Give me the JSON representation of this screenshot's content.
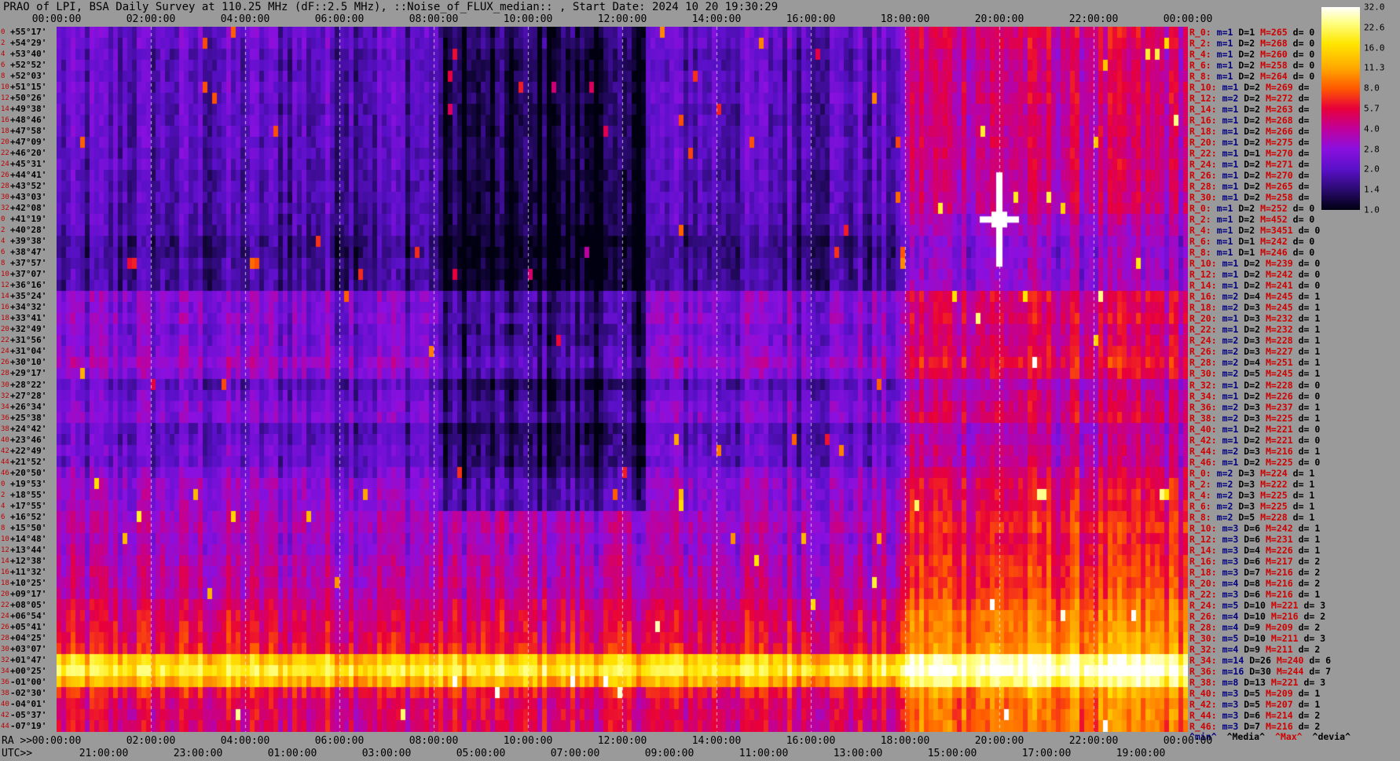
{
  "title": "PRAO of LPI, BSA Daily Survey at 110.25 MHz (dF::2.5 MHz), ::Noise_of_FLUX_median:: , Start Date: 2024 10 20 19:30:29",
  "top_axis_ticks": [
    "00:00:00",
    "02:00:00",
    "04:00:00",
    "06:00:00",
    "08:00:00",
    "10:00:00",
    "12:00:00",
    "14:00:00",
    "16:00:00",
    "18:00:00",
    "20:00:00",
    "22:00:00",
    "00:00:00"
  ],
  "bottom_ra_prefix": "RA >>",
  "bottom_ra_ticks": [
    "00:00:00",
    "02:00:00",
    "04:00:00",
    "06:00:00",
    "08:00:00",
    "10:00:00",
    "12:00:00",
    "14:00:00",
    "16:00:00",
    "18:00:00",
    "20:00:00",
    "22:00:00",
    "00:00:00"
  ],
  "bottom_utc_prefix": "UTC>>",
  "bottom_utc_ticks": [
    "21:00:00",
    "23:00:00",
    "01:00:00",
    "03:00:00",
    "05:00:00",
    "07:00:00",
    "09:00:00",
    "11:00:00",
    "13:00:00",
    "15:00:00",
    "17:00:00",
    "19:00:00"
  ],
  "dec_rows": [
    {
      "idx": "0",
      "dec": "+55°17'"
    },
    {
      "idx": "2",
      "dec": "+54°29'"
    },
    {
      "idx": "4",
      "dec": "+53°40'"
    },
    {
      "idx": "6",
      "dec": "+52°52'"
    },
    {
      "idx": "8",
      "dec": "+52°03'"
    },
    {
      "idx": "10",
      "dec": "+51°15'"
    },
    {
      "idx": "12",
      "dec": "+50°26'"
    },
    {
      "idx": "14",
      "dec": "+49°38'"
    },
    {
      "idx": "16",
      "dec": "+48°46'"
    },
    {
      "idx": "18",
      "dec": "+47°58'"
    },
    {
      "idx": "20",
      "dec": "+47°09'"
    },
    {
      "idx": "22",
      "dec": "+46°20'"
    },
    {
      "idx": "24",
      "dec": "+45°31'"
    },
    {
      "idx": "26",
      "dec": "+44°41'"
    },
    {
      "idx": "28",
      "dec": "+43°52'"
    },
    {
      "idx": "30",
      "dec": "+43°03'"
    },
    {
      "idx": "32",
      "dec": "+42°08'"
    },
    {
      "idx": "0",
      "dec": "+41°19'"
    },
    {
      "idx": "2",
      "dec": "+40°28'"
    },
    {
      "idx": "4",
      "dec": "+39°38'"
    },
    {
      "idx": "6",
      "dec": "+38°47'"
    },
    {
      "idx": "8",
      "dec": "+37°57'"
    },
    {
      "idx": "10",
      "dec": "+37°07'"
    },
    {
      "idx": "12",
      "dec": "+36°16'"
    },
    {
      "idx": "14",
      "dec": "+35°24'"
    },
    {
      "idx": "16",
      "dec": "+34°32'"
    },
    {
      "idx": "18",
      "dec": "+33°41'"
    },
    {
      "idx": "20",
      "dec": "+32°49'"
    },
    {
      "idx": "22",
      "dec": "+31°56'"
    },
    {
      "idx": "24",
      "dec": "+31°04'"
    },
    {
      "idx": "26",
      "dec": "+30°10'"
    },
    {
      "idx": "28",
      "dec": "+29°17'"
    },
    {
      "idx": "30",
      "dec": "+28°22'"
    },
    {
      "idx": "32",
      "dec": "+27°28'"
    },
    {
      "idx": "34",
      "dec": "+26°34'"
    },
    {
      "idx": "36",
      "dec": "+25°38'"
    },
    {
      "idx": "38",
      "dec": "+24°42'"
    },
    {
      "idx": "40",
      "dec": "+23°46'"
    },
    {
      "idx": "42",
      "dec": "+22°49'"
    },
    {
      "idx": "44",
      "dec": "+21°52'"
    },
    {
      "idx": "46",
      "dec": "+20°50'"
    },
    {
      "idx": "0",
      "dec": "+19°53'"
    },
    {
      "idx": "2",
      "dec": "+18°55'"
    },
    {
      "idx": "4",
      "dec": "+17°55'"
    },
    {
      "idx": "6",
      "dec": "+16°52'"
    },
    {
      "idx": "8",
      "dec": "+15°50'"
    },
    {
      "idx": "10",
      "dec": "+14°48'"
    },
    {
      "idx": "12",
      "dec": "+13°44'"
    },
    {
      "idx": "14",
      "dec": "+12°38'"
    },
    {
      "idx": "16",
      "dec": "+11°32'"
    },
    {
      "idx": "18",
      "dec": "+10°25'"
    },
    {
      "idx": "20",
      "dec": "+09°17'"
    },
    {
      "idx": "22",
      "dec": "+08°05'"
    },
    {
      "idx": "24",
      "dec": "+06°54'"
    },
    {
      "idx": "26",
      "dec": "+05°41'"
    },
    {
      "idx": "28",
      "dec": "+04°25'"
    },
    {
      "idx": "30",
      "dec": "+03°07'"
    },
    {
      "idx": "32",
      "dec": "+01°47'"
    },
    {
      "idx": "34",
      "dec": "+00°25'"
    },
    {
      "idx": "36",
      "dec": "-01°00'"
    },
    {
      "idx": "38",
      "dec": "-02°30'"
    },
    {
      "idx": "40",
      "dec": "-04°01'"
    },
    {
      "idx": "42",
      "dec": "-05°37'"
    },
    {
      "idx": "44",
      "dec": "-07°19'"
    }
  ],
  "stats_rows": [
    {
      "r": "R_0:",
      "m": "m=1",
      "d": "D=1",
      "x": "M=265",
      "v": "d= 0"
    },
    {
      "r": "R_2:",
      "m": "m=1",
      "d": "D=2",
      "x": "M=268",
      "v": "d= 0"
    },
    {
      "r": "R_4:",
      "m": "m=1",
      "d": "D=2",
      "x": "M=260",
      "v": "d= 0"
    },
    {
      "r": "R_6:",
      "m": "m=1",
      "d": "D=2",
      "x": "M=258",
      "v": "d= 0"
    },
    {
      "r": "R_8:",
      "m": "m=1",
      "d": "D=2",
      "x": "M=264",
      "v": "d= 0"
    },
    {
      "r": "R_10:",
      "m": "m=1",
      "d": "D=2",
      "x": "M=269",
      "v": "d="
    },
    {
      "r": "R_12:",
      "m": "m=2",
      "d": "D=2",
      "x": "M=272",
      "v": "d="
    },
    {
      "r": "R_14:",
      "m": "m=1",
      "d": "D=2",
      "x": "M=263",
      "v": "d="
    },
    {
      "r": "R_16:",
      "m": "m=1",
      "d": "D=2",
      "x": "M=268",
      "v": "d="
    },
    {
      "r": "R_18:",
      "m": "m=1",
      "d": "D=2",
      "x": "M=266",
      "v": "d="
    },
    {
      "r": "R_20:",
      "m": "m=1",
      "d": "D=2",
      "x": "M=275",
      "v": "d="
    },
    {
      "r": "R_22:",
      "m": "m=1",
      "d": "D=1",
      "x": "M=270",
      "v": "d="
    },
    {
      "r": "R_24:",
      "m": "m=1",
      "d": "D=2",
      "x": "M=271",
      "v": "d="
    },
    {
      "r": "R_26:",
      "m": "m=1",
      "d": "D=2",
      "x": "M=270",
      "v": "d="
    },
    {
      "r": "R_28:",
      "m": "m=1",
      "d": "D=2",
      "x": "M=265",
      "v": "d="
    },
    {
      "r": "R_30:",
      "m": "m=1",
      "d": "D=2",
      "x": "M=258",
      "v": "d="
    },
    {
      "r": "R_0:",
      "m": "m=1",
      "d": "D=2",
      "x": "M=252",
      "v": "d= 0"
    },
    {
      "r": "R_2:",
      "m": "m=1",
      "d": "D=2",
      "x": "M=452",
      "v": "d= 0"
    },
    {
      "r": "R_4:",
      "m": "m=1",
      "d": "D=2",
      "x": "M=3451",
      "v": "d= 0"
    },
    {
      "r": "R_6:",
      "m": "m=1",
      "d": "D=1",
      "x": "M=242",
      "v": "d= 0"
    },
    {
      "r": "R_8:",
      "m": "m=1",
      "d": "D=1",
      "x": "M=246",
      "v": "d= 0"
    },
    {
      "r": "R_10:",
      "m": "m=1",
      "d": "D=2",
      "x": "M=239",
      "v": "d= 0"
    },
    {
      "r": "R_12:",
      "m": "m=1",
      "d": "D=2",
      "x": "M=242",
      "v": "d= 0"
    },
    {
      "r": "R_14:",
      "m": "m=1",
      "d": "D=2",
      "x": "M=241",
      "v": "d= 0"
    },
    {
      "r": "R_16:",
      "m": "m=2",
      "d": "D=4",
      "x": "M=245",
      "v": "d= 1"
    },
    {
      "r": "R_18:",
      "m": "m=2",
      "d": "D=3",
      "x": "M=245",
      "v": "d= 1"
    },
    {
      "r": "R_20:",
      "m": "m=1",
      "d": "D=3",
      "x": "M=232",
      "v": "d= 1"
    },
    {
      "r": "R_22:",
      "m": "m=1",
      "d": "D=2",
      "x": "M=232",
      "v": "d= 1"
    },
    {
      "r": "R_24:",
      "m": "m=2",
      "d": "D=3",
      "x": "M=228",
      "v": "d= 1"
    },
    {
      "r": "R_26:",
      "m": "m=2",
      "d": "D=3",
      "x": "M=227",
      "v": "d= 1"
    },
    {
      "r": "R_28:",
      "m": "m=2",
      "d": "D=4",
      "x": "M=251",
      "v": "d= 1"
    },
    {
      "r": "R_30:",
      "m": "m=2",
      "d": "D=5",
      "x": "M=245",
      "v": "d= 1"
    },
    {
      "r": "R_32:",
      "m": "m=1",
      "d": "D=2",
      "x": "M=228",
      "v": "d= 0"
    },
    {
      "r": "R_34:",
      "m": "m=1",
      "d": "D=2",
      "x": "M=226",
      "v": "d= 0"
    },
    {
      "r": "R_36:",
      "m": "m=2",
      "d": "D=3",
      "x": "M=237",
      "v": "d= 1"
    },
    {
      "r": "R_38:",
      "m": "m=2",
      "d": "D=3",
      "x": "M=225",
      "v": "d= 1"
    },
    {
      "r": "R_40:",
      "m": "m=1",
      "d": "D=2",
      "x": "M=221",
      "v": "d= 0"
    },
    {
      "r": "R_42:",
      "m": "m=1",
      "d": "D=2",
      "x": "M=221",
      "v": "d= 0"
    },
    {
      "r": "R_44:",
      "m": "m=2",
      "d": "D=3",
      "x": "M=216",
      "v": "d= 1"
    },
    {
      "r": "R_46:",
      "m": "m=1",
      "d": "D=2",
      "x": "M=225",
      "v": "d= 0"
    },
    {
      "r": "R_0:",
      "m": "m=2",
      "d": "D=3",
      "x": "M=224",
      "v": "d= 1"
    },
    {
      "r": "R_2:",
      "m": "m=2",
      "d": "D=3",
      "x": "M=222",
      "v": "d= 1"
    },
    {
      "r": "R_4:",
      "m": "m=2",
      "d": "D=3",
      "x": "M=225",
      "v": "d= 1"
    },
    {
      "r": "R_6:",
      "m": "m=2",
      "d": "D=3",
      "x": "M=225",
      "v": "d= 1"
    },
    {
      "r": "R_8:",
      "m": "m=2",
      "d": "D=5",
      "x": "M=228",
      "v": "d= 1"
    },
    {
      "r": "R_10:",
      "m": "m=3",
      "d": "D=6",
      "x": "M=242",
      "v": "d= 1"
    },
    {
      "r": "R_12:",
      "m": "m=3",
      "d": "D=6",
      "x": "M=231",
      "v": "d= 1"
    },
    {
      "r": "R_14:",
      "m": "m=3",
      "d": "D=4",
      "x": "M=226",
      "v": "d= 1"
    },
    {
      "r": "R_16:",
      "m": "m=3",
      "d": "D=6",
      "x": "M=217",
      "v": "d= 2"
    },
    {
      "r": "R_18:",
      "m": "m=3",
      "d": "D=7",
      "x": "M=216",
      "v": "d= 2"
    },
    {
      "r": "R_20:",
      "m": "m=4",
      "d": "D=8",
      "x": "M=216",
      "v": "d= 2"
    },
    {
      "r": "R_22:",
      "m": "m=3",
      "d": "D=6",
      "x": "M=216",
      "v": "d= 1"
    },
    {
      "r": "R_24:",
      "m": "m=5",
      "d": "D=10",
      "x": "M=221",
      "v": "d= 3"
    },
    {
      "r": "R_26:",
      "m": "m=4",
      "d": "D=10",
      "x": "M=216",
      "v": "d= 2"
    },
    {
      "r": "R_28:",
      "m": "m=4",
      "d": "D=9",
      "x": "M=209",
      "v": "d= 2"
    },
    {
      "r": "R_30:",
      "m": "m=5",
      "d": "D=10",
      "x": "M=211",
      "v": "d= 3"
    },
    {
      "r": "R_32:",
      "m": "m=4",
      "d": "D=9",
      "x": "M=211",
      "v": "d= 2"
    },
    {
      "r": "R_34:",
      "m": "m=14",
      "d": "D=26",
      "x": "M=240",
      "v": "d= 6"
    },
    {
      "r": "R_36:",
      "m": "m=16",
      "d": "D=30",
      "x": "M=244",
      "v": "d= 7"
    },
    {
      "r": "R_38:",
      "m": "m=8",
      "d": "D=13",
      "x": "M=221",
      "v": "d= 3"
    },
    {
      "r": "R_40:",
      "m": "m=3",
      "d": "D=5",
      "x": "M=209",
      "v": "d= 1"
    },
    {
      "r": "R_42:",
      "m": "m=3",
      "d": "D=5",
      "x": "M=207",
      "v": "d= 1"
    },
    {
      "r": "R_44:",
      "m": "m=3",
      "d": "D=6",
      "x": "M=214",
      "v": "d= 2"
    },
    {
      "r": "R_46:",
      "m": "m=3",
      "d": "D=7",
      "x": "M=216",
      "v": "d= 2"
    }
  ],
  "stats_footer": {
    "min": "^min^",
    "media": "^Media^",
    "max": "^Max^",
    "devia": "^devia^"
  },
  "colorbar": {
    "ticks": [
      "32.0",
      "22.6",
      "16.0",
      "11.3",
      "8.0",
      "5.7",
      "4.0",
      "2.8",
      "2.0",
      "1.4",
      "1.0"
    ],
    "scale": "log2",
    "range": [
      1.0,
      32.0
    ],
    "colors": [
      "#000010",
      "#2a0a70",
      "#5a10c8",
      "#8a10e0",
      "#c0009a",
      "#e8003a",
      "#ff5a00",
      "#ffa800",
      "#ffe600",
      "#ffff80",
      "#ffffff"
    ]
  },
  "chart_data": {
    "type": "heatmap",
    "title": "PRAO of LPI, BSA Daily Survey at 110.25 MHz (dF::2.5 MHz), ::Noise_of_FLUX_median:: , Start Date: 2024 10 20 19:30:29",
    "x_axis": "RA (hours)",
    "x_range": [
      0,
      24
    ],
    "rows": 64,
    "value_range": [
      1.0,
      32.0
    ],
    "row_base_levels": [
      2.2,
      2.2,
      2.0,
      2.0,
      2.0,
      2.1,
      2.1,
      2.0,
      2.0,
      2.0,
      2.0,
      2.0,
      2.0,
      1.9,
      1.9,
      1.9,
      1.9,
      1.9,
      1.8,
      1.6,
      1.6,
      1.7,
      1.7,
      1.7,
      2.8,
      2.6,
      2.8,
      2.5,
      2.6,
      2.8,
      3.2,
      2.8,
      2.0,
      2.3,
      2.6,
      2.7,
      2.0,
      2.1,
      2.3,
      2.2,
      2.6,
      3.0,
      3.0,
      3.0,
      3.4,
      3.6,
      3.2,
      3.3,
      3.6,
      3.8,
      3.8,
      4.0,
      4.6,
      5.0,
      5.2,
      5.5,
      6.0,
      14.0,
      18.0,
      12.0,
      6.0,
      5.0,
      5.0,
      5.0
    ],
    "ra_hot_band_hours": [
      18.0,
      24.0
    ],
    "bright_source": {
      "ra_hours": 20.0,
      "row": 17,
      "value": 32.0
    },
    "hot_row_pairs": [
      [
        57,
        58
      ]
    ]
  }
}
